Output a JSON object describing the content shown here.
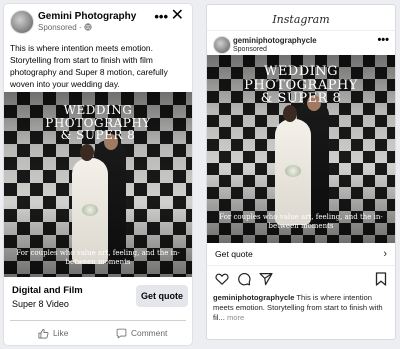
{
  "facebook": {
    "page_name": "Gemini Photography",
    "sponsored": "Sponsored ·",
    "more_icon": "more-horizontal-icon",
    "close_icon": "close-icon",
    "caption": "This is where intention meets emotion. Storytelling from start to finish with film photography and Super 8 motion, carefully woven into your wedding day.",
    "ad_image": {
      "title": "WEDDING\nPHOTOGRAPHY\n& SUPER 8",
      "tagline": "For couples who value art, feeling, and the in-between moments"
    },
    "cta": {
      "headline": "Digital and Film",
      "subline": "Super 8 Video",
      "button": "Get quote"
    },
    "actions": {
      "like": "Like",
      "comment": "Comment"
    }
  },
  "instagram": {
    "logo": "Instagram",
    "username": "geminiphotographycle",
    "sponsored": "Sponsored",
    "ad_image": {
      "title": "WEDDING\nPHOTOGRAPHY\n& SUPER 8",
      "tagline": "For couples who value art, feeling, and the in-between moments"
    },
    "cta": "Get quote",
    "caption_user": "geminiphotographycle",
    "caption_text": " This is where intention meets emotion. Storytelling from start to finish with fil...",
    "caption_more": " more"
  }
}
